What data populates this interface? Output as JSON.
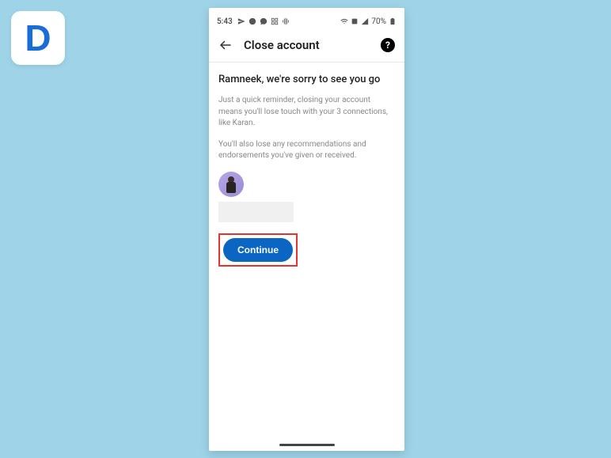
{
  "logo": {
    "letter": "D"
  },
  "status": {
    "time": "5:43",
    "battery": "70%"
  },
  "header": {
    "title": "Close account"
  },
  "content": {
    "heading": "Ramneek, we're sorry to see you go",
    "para1": "Just a quick reminder, closing your account means you'll lose touch with your 3 connections, like Karan.",
    "para2": "You'll also lose any recommendations and endorsements you've given or received.",
    "continue_label": "Continue"
  }
}
